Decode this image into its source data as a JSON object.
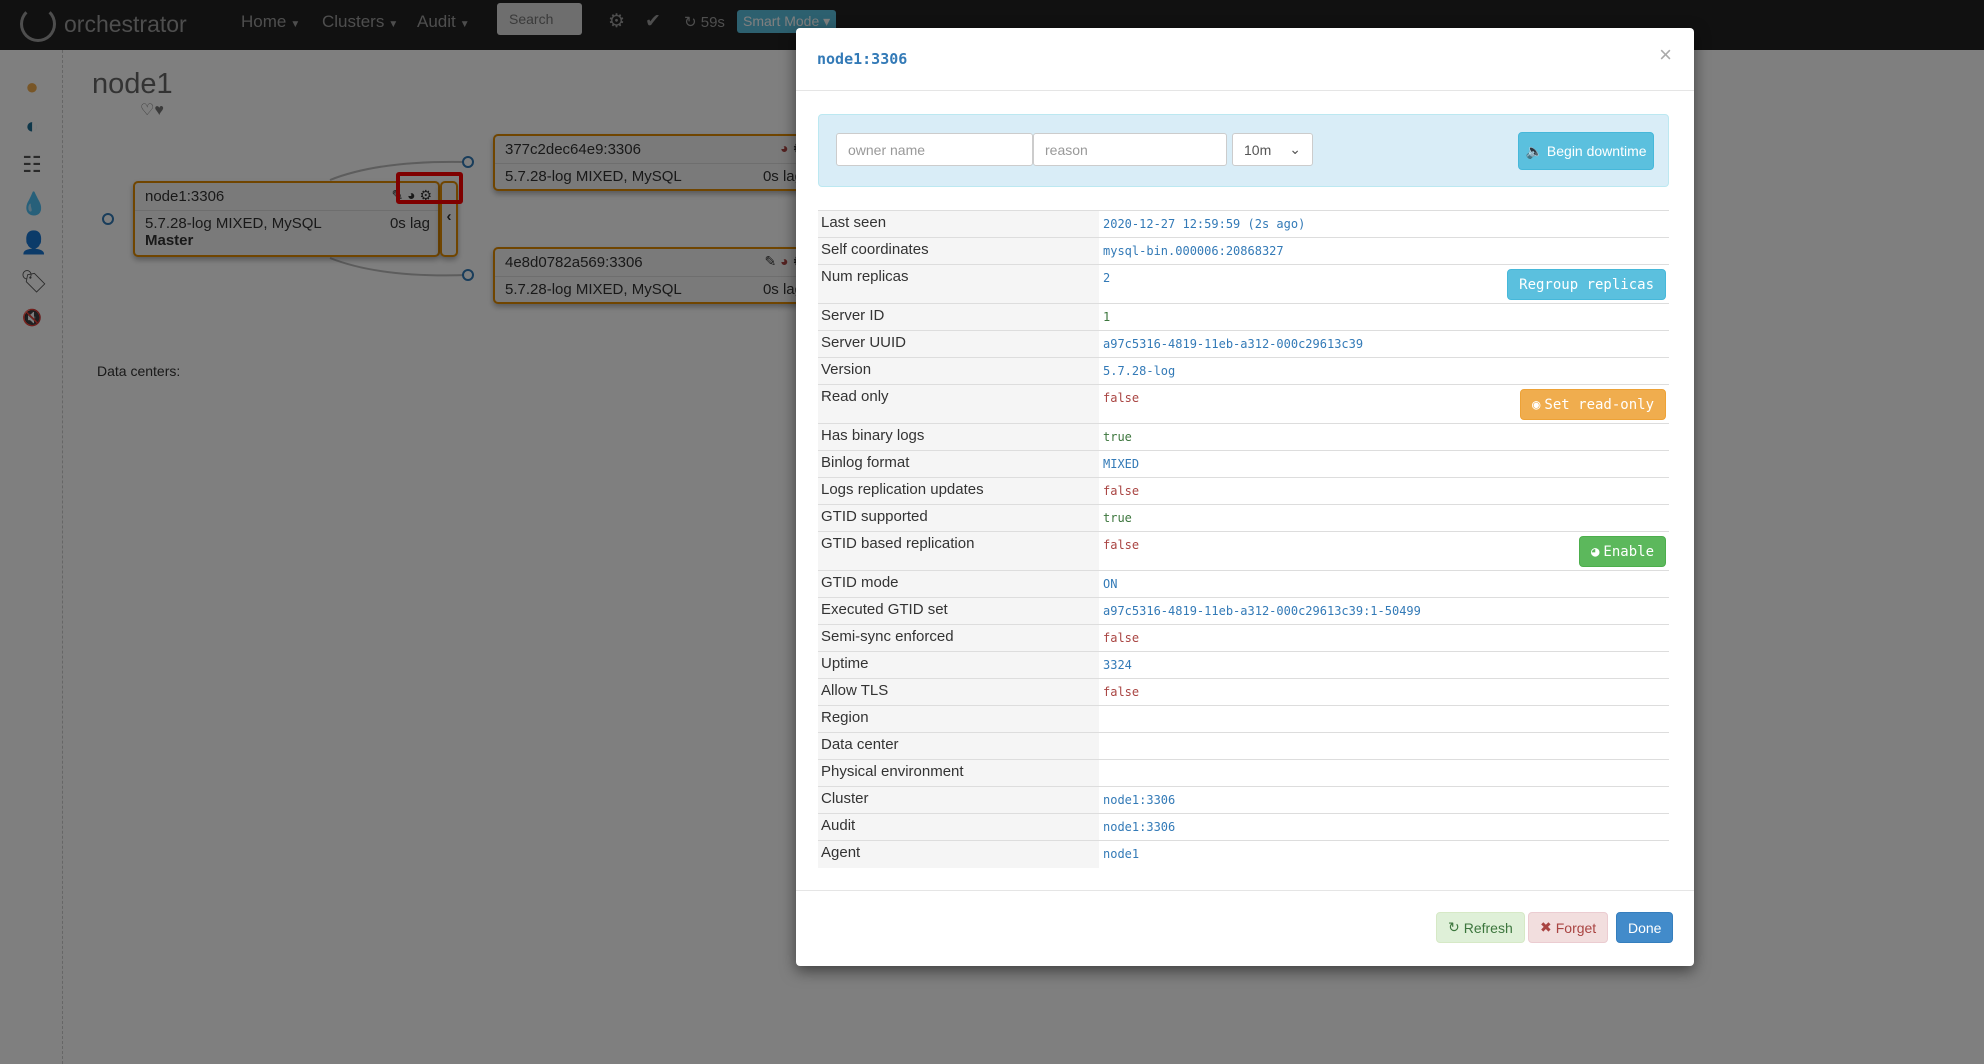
{
  "navbar": {
    "brand": "orchestrator",
    "menu": [
      {
        "label": "Home"
      },
      {
        "label": "Clusters"
      },
      {
        "label": "Audit"
      }
    ],
    "search_placeholder": "Search",
    "refresh_countdown": "59s",
    "mode": "Smart Mode"
  },
  "sidebar": {
    "icons": [
      "exclamation-circle-icon",
      "contrast-icon",
      "list-icon",
      "tint-icon",
      "user-icon",
      "tag-icon",
      "volume-off-icon"
    ]
  },
  "page": {
    "title": "node1",
    "hearts": "♡♥",
    "data_centers_label": "Data centers:"
  },
  "topology": {
    "master": {
      "name": "node1:3306",
      "version": "5.7.28-log MIXED, MySQL",
      "lag": "0s lag",
      "role": "Master"
    },
    "replicas": [
      {
        "name": "377c2dec64e9:3306",
        "version": "5.7.28-log MIXED, MySQL",
        "lag": "0s lag"
      },
      {
        "name": "4e8d0782a569:3306",
        "version": "5.7.28-log MIXED, MySQL",
        "lag": "0s lag"
      }
    ],
    "border_color": "#e08a00"
  },
  "modal": {
    "title": "node1:3306",
    "downtime": {
      "owner_placeholder": "owner name",
      "reason_placeholder": "reason",
      "duration": "10m",
      "button": "Begin downtime"
    },
    "rows": [
      {
        "label": "Last seen",
        "value": "2020-12-27 12:59:59 (2s ago)",
        "color": "blue"
      },
      {
        "label": "Self coordinates",
        "value": "mysql-bin.000006:20868327",
        "color": "blue"
      },
      {
        "label": "Num replicas",
        "value": "2",
        "color": "blue",
        "button": "Regroup replicas",
        "button_style": "info"
      },
      {
        "label": "Server ID",
        "value": "1",
        "color": "green"
      },
      {
        "label": "Server UUID",
        "value": "a97c5316-4819-11eb-a312-000c29613c39",
        "color": "blue"
      },
      {
        "label": "Version",
        "value": "5.7.28-log",
        "color": "blue"
      },
      {
        "label": "Read only",
        "value": "false",
        "color": "red",
        "button": "Set read-only",
        "button_style": "warn",
        "button_icon": "eye-icon"
      },
      {
        "label": "Has binary logs",
        "value": "true",
        "color": "green"
      },
      {
        "label": "Binlog format",
        "value": "MIXED",
        "color": "blue"
      },
      {
        "label": "Logs replication updates",
        "value": "false",
        "color": "red"
      },
      {
        "label": "GTID supported",
        "value": "true",
        "color": "green"
      },
      {
        "label": "GTID based replication",
        "value": "false",
        "color": "red",
        "button": "Enable",
        "button_style": "succ",
        "button_icon": "globe-icon"
      },
      {
        "label": "GTID mode",
        "value": "ON",
        "color": "blue"
      },
      {
        "label": "Executed GTID set",
        "value": "a97c5316-4819-11eb-a312-000c29613c39:1-50499",
        "color": "blue"
      },
      {
        "label": "Semi-sync enforced",
        "value": "false",
        "color": "red"
      },
      {
        "label": "Uptime",
        "value": "3324",
        "color": "blue"
      },
      {
        "label": "Allow TLS",
        "value": "false",
        "color": "red"
      },
      {
        "label": "Region",
        "value": "",
        "color": "blue"
      },
      {
        "label": "Data center",
        "value": "",
        "color": "blue"
      },
      {
        "label": "Physical environment",
        "value": "",
        "color": "blue"
      },
      {
        "label": "Cluster",
        "value": "node1:3306",
        "color": "blue"
      },
      {
        "label": "Audit",
        "value": "node1:3306",
        "color": "blue"
      },
      {
        "label": "Agent",
        "value": "node1",
        "color": "blue"
      }
    ],
    "footer": {
      "refresh": "Refresh",
      "forget": "Forget",
      "done": "Done"
    }
  }
}
